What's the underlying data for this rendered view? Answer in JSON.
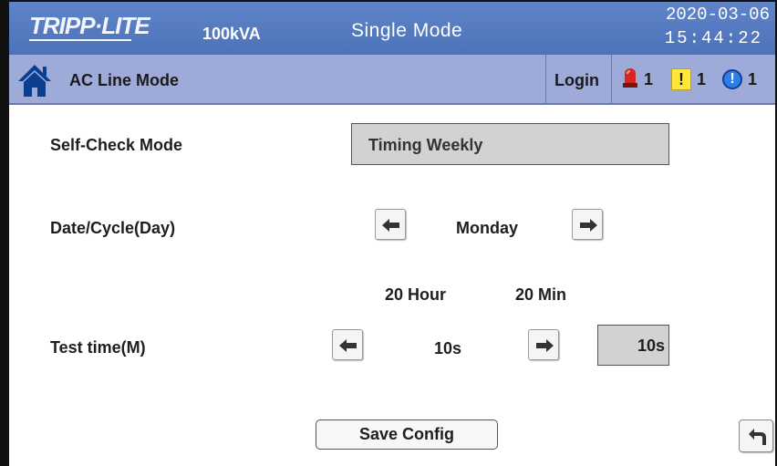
{
  "header": {
    "logo": "TRIPP·LITE",
    "capacity": "100kVA",
    "mode": "Single Mode",
    "date": "2020-03-06",
    "time": "15:44:22"
  },
  "statusbar": {
    "home_icon": "home-icon",
    "status": "AC Line Mode",
    "login": "Login",
    "alarms": [
      {
        "icon": "siren-alarm-icon",
        "count": "1",
        "color": "#d9261c"
      },
      {
        "icon": "warning-icon",
        "symbol": "!",
        "count": "1",
        "color": "#ffe83a"
      },
      {
        "icon": "info-icon",
        "symbol": "!",
        "count": "1",
        "color": "#2f7ee5"
      }
    ]
  },
  "form": {
    "self_check": {
      "label": "Self-Check Mode",
      "value": "Timing Weekly"
    },
    "date_cycle": {
      "label": "Date/Cycle(Day)",
      "value": "Monday"
    },
    "time": {
      "hour": "20 Hour",
      "minute": "20 Min"
    },
    "test_time": {
      "label": "Test time(M)",
      "value": "10s",
      "current": "10s"
    }
  },
  "actions": {
    "save": "Save Config",
    "back_icon": "return-arrow-icon"
  }
}
